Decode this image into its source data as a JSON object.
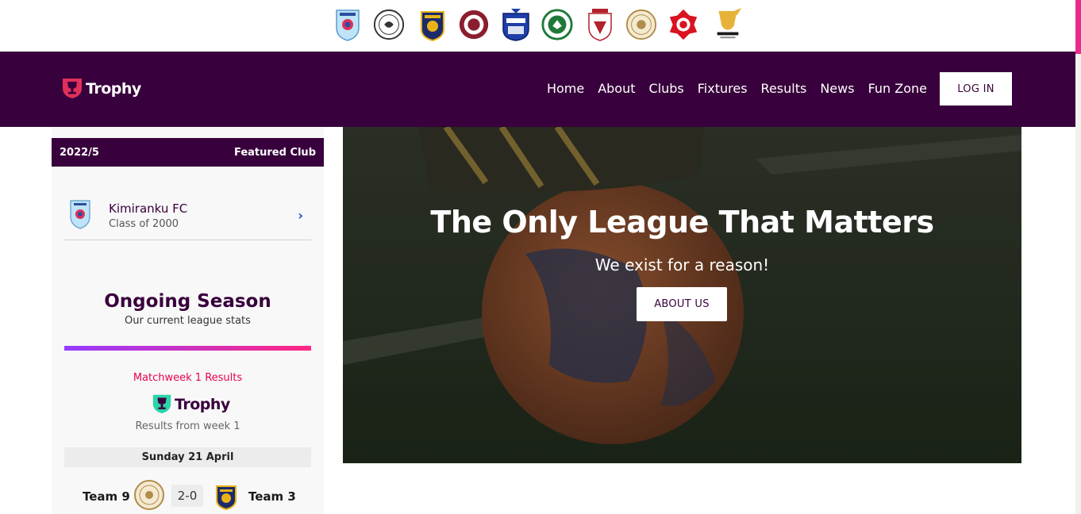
{
  "clubs": [
    {
      "icon": "kimiranku-crest-icon"
    },
    {
      "icon": "club-crest-2-icon"
    },
    {
      "icon": "club-crest-3-icon"
    },
    {
      "icon": "club-crest-4-icon"
    },
    {
      "icon": "club-crest-5-icon"
    },
    {
      "icon": "club-crest-6-icon"
    },
    {
      "icon": "club-crest-7-icon"
    },
    {
      "icon": "club-crest-8-icon"
    },
    {
      "icon": "club-crest-9-icon"
    },
    {
      "icon": "visakha-crest-icon"
    }
  ],
  "header": {
    "brand": "Trophy",
    "nav": [
      "Home",
      "About",
      "Clubs",
      "Fixtures",
      "Results",
      "News",
      "Fun Zone"
    ],
    "login_label": "LOG IN"
  },
  "sidebar": {
    "season": "2022/5",
    "featured_label": "Featured Club",
    "featured_club": {
      "name": "Kimiranku FC",
      "subtitle": "Class of 2000"
    },
    "ongoing": {
      "title": "Ongoing Season",
      "subtitle": "Our current league stats"
    },
    "matchweek": {
      "title": "Matchweek 1 Results",
      "brand": "Trophy",
      "subtitle": "Results from week 1",
      "date": "Sunday 21 April",
      "match": {
        "home": "Team 9",
        "score": "2-0",
        "away": "Team 3"
      }
    }
  },
  "hero": {
    "title": "The Only League That Matters",
    "subtitle": "We exist for a reason!",
    "button_label": "ABOUT US"
  },
  "colors": {
    "primary": "#38003c",
    "accent": "#e90052",
    "gradient_start": "#963cff",
    "gradient_end": "#ff2882"
  }
}
